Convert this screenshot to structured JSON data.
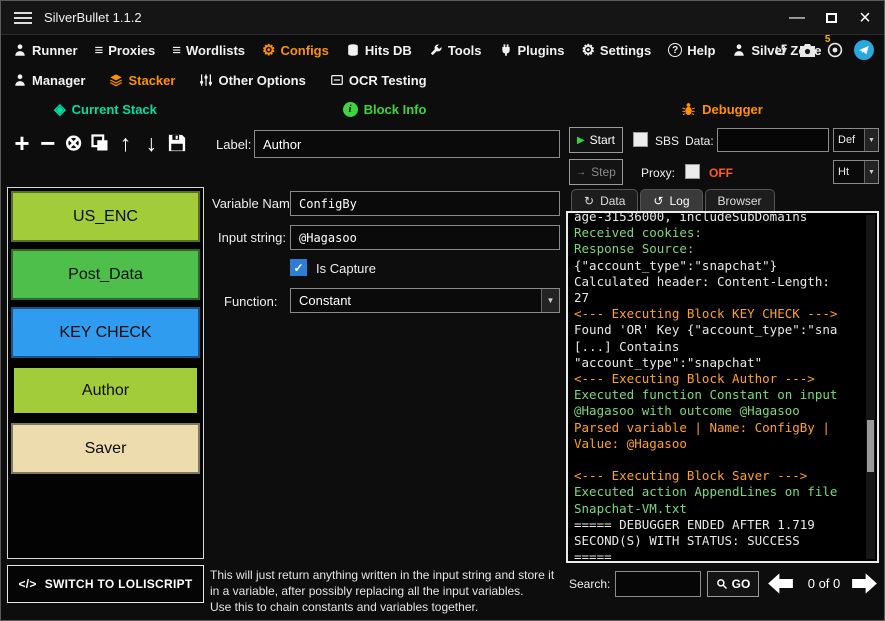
{
  "window": {
    "title": "SilverBullet 1.1.2"
  },
  "icons": {
    "add": "+",
    "remove": "−",
    "clear": "⊗",
    "up": "↑",
    "down": "↓",
    "list": "≡",
    "gear": "⚙",
    "history": "↺",
    "refresh": "↻",
    "clock": "↺",
    "diamond": "◈",
    "play": "▶",
    "step": "→",
    "dropdown": "▼",
    "check": "✓",
    "code": "</>",
    "info": "i",
    "question": "?",
    "minimize": "—",
    "close": "×"
  },
  "colors": {
    "stack_accent": "#00dfa2",
    "block_info_accent": "#3dd43d",
    "debugger_accent": "#ff9100",
    "nav_active": "#ff9100",
    "proxy_off": "#ff5a1f",
    "checkbox_checked": "#2d7dd2",
    "telegram_blue": "#29a8dd",
    "log_white": "#e8e8e8",
    "log_green": "#7bd87b",
    "log_orange": "#ffa21f"
  },
  "nav": {
    "items": [
      {
        "label": "Runner"
      },
      {
        "label": "Proxies"
      },
      {
        "label": "Wordlists"
      },
      {
        "label": "Configs",
        "active": true
      },
      {
        "label": "Hits DB"
      },
      {
        "label": "Tools"
      },
      {
        "label": "Plugins"
      },
      {
        "label": "Settings"
      },
      {
        "label": "Help"
      },
      {
        "label": "Silver Zone",
        "badge": "5"
      }
    ]
  },
  "subnav": {
    "items": [
      {
        "label": "Manager"
      },
      {
        "label": "Stacker",
        "active": true
      },
      {
        "label": "Other Options"
      },
      {
        "label": "OCR Testing"
      }
    ]
  },
  "stack": {
    "title": "Current Stack",
    "switch_label": "SWITCH TO LOLISCRIPT",
    "blocks": [
      {
        "label": "US_ENC",
        "color": "#a3cc3a",
        "selected": false
      },
      {
        "label": "Post_Data",
        "color": "#4dbf4a",
        "selected": false
      },
      {
        "label": "KEY CHECK",
        "color": "#2f9cf0",
        "selected": false
      },
      {
        "label": "Author",
        "color": "#a3cc3a",
        "selected": true
      },
      {
        "label": "Saver",
        "color": "#ecdcae",
        "selected": false
      }
    ]
  },
  "block_info": {
    "title": "Block Info",
    "label_caption": "Label:",
    "label_value": "Author",
    "variable_name_caption": "Variable Name:",
    "variable_name_value": "ConfigBy",
    "input_string_caption": "Input string:",
    "input_string_value": "@Hagasoo",
    "is_capture_label": "Is Capture",
    "is_capture_checked": true,
    "function_caption": "Function:",
    "function_value": "Constant",
    "description_line1": "This will just return anything written in the input string and store it in a variable, after possibly replacing all the input variables.",
    "description_line2": "Use this to chain constants and variables together."
  },
  "debugger": {
    "title": "Debugger",
    "start_label": "Start",
    "step_label": "Step",
    "sbs_label": "SBS",
    "data_label": "Data:",
    "data_value": "",
    "data_type_value": "Def",
    "proxy_label": "Proxy:",
    "proxy_off": "OFF",
    "proxy_type_value": "Ht",
    "tabs": [
      {
        "label": "Data"
      },
      {
        "label": "Log",
        "active": true
      },
      {
        "label": "Browser"
      }
    ],
    "log_lines": [
      {
        "text": "age-31536000, includeSubDomains",
        "color": "white"
      },
      {
        "text": "Received cookies:",
        "color": "green"
      },
      {
        "text": "Response Source:",
        "color": "green"
      },
      {
        "text": "{\"account_type\":\"snapchat\"}",
        "color": "white"
      },
      {
        "text": "Calculated header: Content-Length:",
        "color": "white"
      },
      {
        "text": "27",
        "color": "white"
      },
      {
        "text": "<--- Executing Block KEY CHECK --->",
        "color": "orange"
      },
      {
        "text": "Found 'OR' Key {\"account_type\":\"sna",
        "color": "white"
      },
      {
        "text": "[...] Contains",
        "color": "white"
      },
      {
        "text": "\"account_type\":\"snapchat\"",
        "color": "white"
      },
      {
        "text": "<--- Executing Block Author --->",
        "color": "orange"
      },
      {
        "text": "Executed function Constant on input",
        "color": "green"
      },
      {
        "text": "@Hagasoo with outcome @Hagasoo",
        "color": "green"
      },
      {
        "text": "Parsed variable | Name: ConfigBy |",
        "color": "orange"
      },
      {
        "text": "Value: @Hagasoo",
        "color": "orange"
      },
      {
        "text": "",
        "color": "white"
      },
      {
        "text": "<--- Executing Block Saver --->",
        "color": "orange"
      },
      {
        "text": "Executed action AppendLines on file",
        "color": "green"
      },
      {
        "text": "Snapchat-VM.txt",
        "color": "green"
      },
      {
        "text": "===== DEBUGGER ENDED AFTER 1.719",
        "color": "white"
      },
      {
        "text": "SECOND(S) WITH STATUS: SUCCESS",
        "color": "white"
      },
      {
        "text": "=====",
        "color": "white"
      }
    ],
    "search_label": "Search:",
    "search_value": "",
    "go_label": "GO",
    "counter": "0 of 0"
  }
}
